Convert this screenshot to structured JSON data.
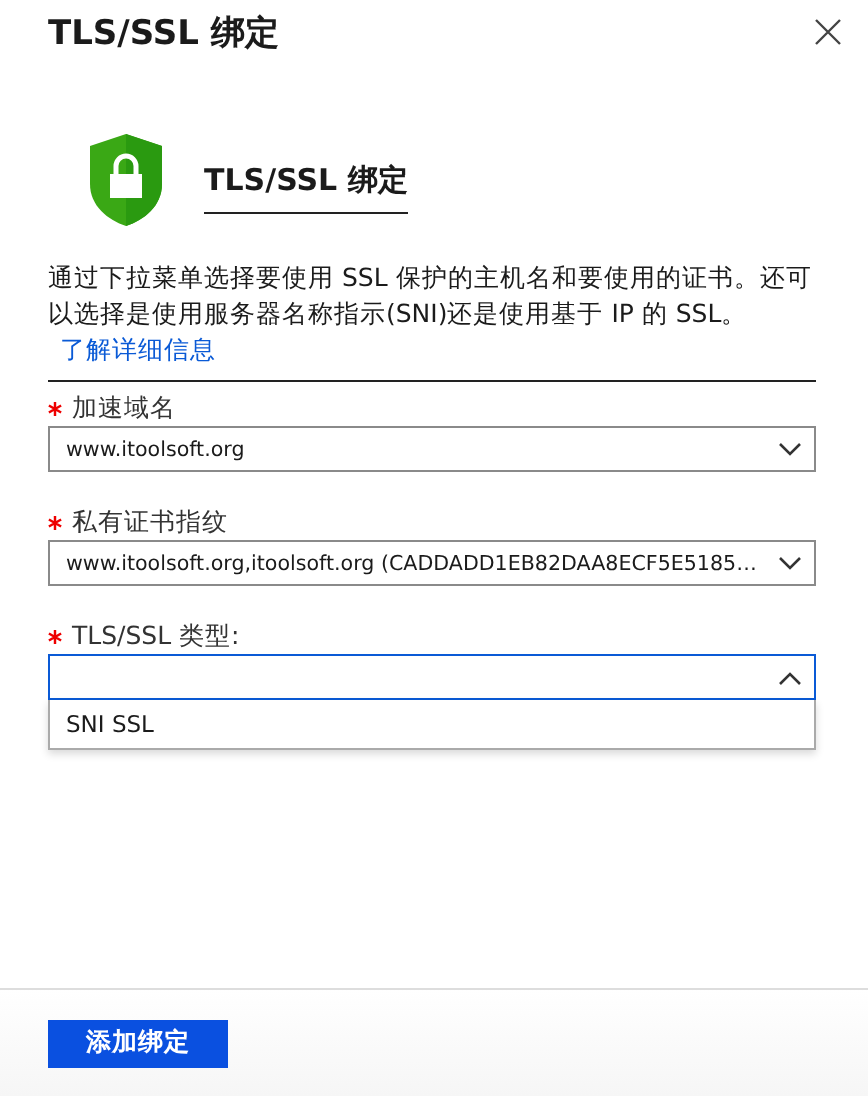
{
  "window": {
    "title": "TLS/SSL 绑定"
  },
  "heading": "TLS/SSL 绑定",
  "description": {
    "text": "通过下拉菜单选择要使用 SSL 保护的主机名和要使用的证书。还可以选择是使用服务器名称指示(SNI)还是使用基于 IP 的 SSL。",
    "link": "了解详细信息"
  },
  "fields": [
    {
      "label": "加速域名",
      "required": true,
      "value": "www.itoolsoft.org",
      "expanded": false
    },
    {
      "label": "私有证书指纹",
      "required": true,
      "value": "www.itoolsoft.org,itoolsoft.org (CADDADD1EB82DAA8ECF5E5185…",
      "expanded": false
    },
    {
      "label": "TLS/SSL 类型:",
      "required": true,
      "expanded": true,
      "options": [
        {
          "label": "SNI SSL",
          "selected": false
        }
      ]
    }
  ],
  "buttons": [
    {
      "label": "添加绑定"
    }
  ]
}
